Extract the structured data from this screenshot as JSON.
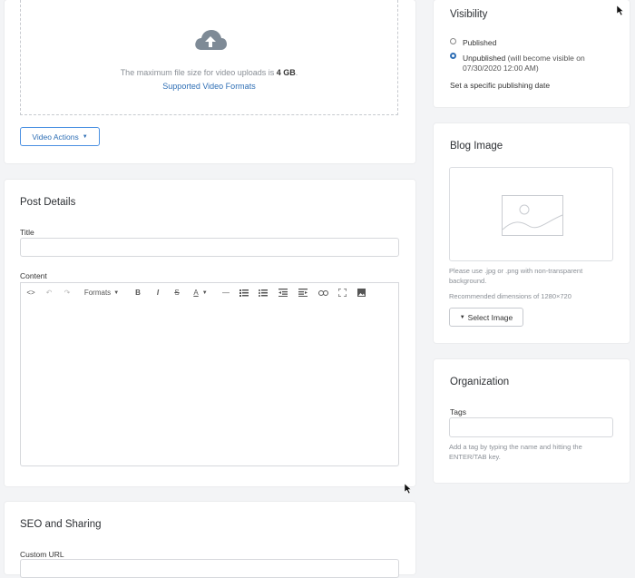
{
  "upload": {
    "max_size_prefix": "The maximum file size for video uploads is",
    "max_size_value": "4 GB",
    "max_size_suffix": ".",
    "supported_link": "Supported Video Formats",
    "actions_label": "Video Actions",
    "icon": "cloud-upload-icon"
  },
  "post_details": {
    "title": "Post Details",
    "title_label": "Title",
    "title_value": "",
    "content_label": "Content",
    "toolbar": {
      "formats_label": "Formats",
      "bold": "B",
      "italic": "I",
      "strike": "S",
      "font_color": "A",
      "hr": "—"
    }
  },
  "seo": {
    "title": "SEO and Sharing",
    "custom_url_label": "Custom URL"
  },
  "visibility": {
    "title": "Visibility",
    "options": [
      {
        "label": "Published",
        "selected": false
      },
      {
        "label": "Unpublished",
        "note": "(will become visible on 07/30/2020 12:00 AM)",
        "selected": true
      }
    ],
    "set_date_link": "Set a specific publishing date"
  },
  "blog_image": {
    "title": "Blog Image",
    "help_format": "Please use .jpg or .png with non-transparent background.",
    "help_dimensions": "Recommended dimensions of 1280×720",
    "select_label": "Select Image",
    "icon": "image-placeholder-icon"
  },
  "organization": {
    "title": "Organization",
    "tags_label": "Tags",
    "tags_value": "",
    "tags_help": "Add a tag by typing the name and hitting the ENTER/TAB key."
  },
  "colors": {
    "accent": "#2f6fb5",
    "background": "#f3f4f6",
    "card": "#ffffff",
    "muted_text": "#8a8f96"
  }
}
